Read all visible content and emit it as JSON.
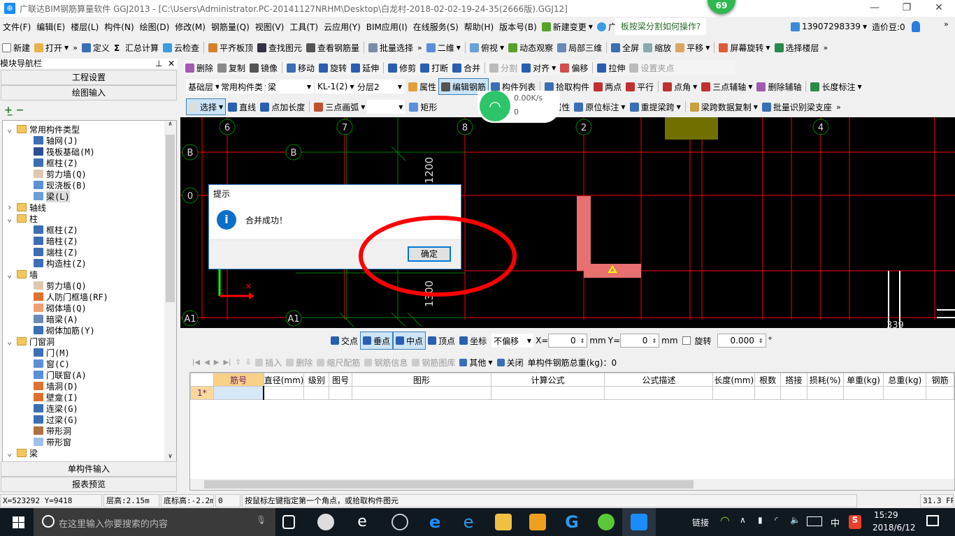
{
  "window": {
    "title": "广联达BIM钢筋算量软件 GGJ2013 - [C:\\Users\\Administrator.PC-20141127NRHM\\Desktop\\白龙村-2018-02-02-19-24-35(2666版).GGJ12]",
    "badge": "69"
  },
  "menu": {
    "items": [
      "文件(F)",
      "编辑(E)",
      "楼层(L)",
      "构件(N)",
      "绘图(D)",
      "修改(M)",
      "钢筋量(Q)",
      "视图(V)",
      "工具(T)",
      "云应用(Y)",
      "BIM应用(I)",
      "在线服务(S)",
      "帮助(H)",
      "版本号(B)"
    ],
    "new_change": "新建变更",
    "assistant": "广小二",
    "question": "板按梁分割如何操作?",
    "account": "13907298339",
    "beans": "造价豆:0"
  },
  "toolbar1": [
    {
      "label": "新建",
      "icon": "new-file-icon",
      "color": "#ffffff"
    },
    {
      "label": "打开",
      "icon": "open-folder-icon",
      "color": "#e8b44a",
      "dd": true
    },
    {
      "label": "»",
      "icon": ""
    },
    {
      "label": "定义",
      "icon": "define-icon",
      "color": "#3a6fb5"
    },
    {
      "label": "汇总计算",
      "icon": "sigma-icon",
      "color": ""
    },
    {
      "label": "云检查",
      "icon": "cloud-check-icon",
      "color": "#3b9be0"
    },
    {
      "label": "平齐板顶",
      "icon": "align-slab-icon",
      "color": "#d4822e"
    },
    {
      "label": "查找图元",
      "icon": "binoculars-icon",
      "color": "#334"
    },
    {
      "label": "查看钢筋量",
      "icon": "glasses-icon",
      "color": "#555"
    },
    {
      "label": "批量选择",
      "icon": "batch-select-icon",
      "color": "#7a8ca8"
    },
    {
      "label": "»",
      "icon": ""
    },
    {
      "label": "二维",
      "icon": "2d-icon",
      "color": "#5b8fd8",
      "dd": true
    },
    {
      "label": "俯视",
      "icon": "top-view-icon",
      "color": "#6aa0d8",
      "dd": true
    },
    {
      "label": "动态观察",
      "icon": "orbit-icon",
      "color": "#5aa02c"
    },
    {
      "label": "局部三维",
      "icon": "local-3d-icon",
      "color": "#6a8ab8"
    },
    {
      "label": "全屏",
      "icon": "fullscreen-icon",
      "color": "#3a6fb5"
    },
    {
      "label": "缩放",
      "icon": "zoom-icon",
      "color": "#8aa"
    },
    {
      "label": "平移",
      "icon": "pan-hand-icon",
      "color": "#d8a860",
      "dd": true
    },
    {
      "label": "屏幕旋转",
      "icon": "rotate-screen-icon",
      "color": "#e05a3a",
      "dd": true
    },
    {
      "label": "选择楼层",
      "icon": "select-floor-icon",
      "color": "#2a8a4a"
    },
    {
      "label": "»",
      "icon": ""
    }
  ],
  "toolbar2": [
    {
      "label": "删除",
      "icon": "delete-icon",
      "color": "#a05ab0"
    },
    {
      "label": "复制",
      "icon": "copy-icon",
      "color": "#8a8a8a"
    },
    {
      "label": "镜像",
      "icon": "mirror-icon",
      "color": "#555"
    },
    {
      "label": "移动",
      "icon": "move-icon",
      "color": "#3a6fb5"
    },
    {
      "label": "旋转",
      "icon": "rotate-icon",
      "color": "#2a5fb0"
    },
    {
      "label": "延伸",
      "icon": "extend-icon",
      "color": "#2a5fb0"
    },
    {
      "label": "修剪",
      "icon": "trim-icon",
      "color": "#2a5fb0"
    },
    {
      "label": "打断",
      "icon": "break-icon",
      "color": "#2a5fb0"
    },
    {
      "label": "合并",
      "icon": "merge-icon",
      "color": "#2a5fb0"
    },
    {
      "label": "分割",
      "icon": "split-icon",
      "color": "#bbb",
      "disabled": true
    },
    {
      "label": "对齐",
      "icon": "align-icon",
      "color": "#2a5fb0",
      "dd": true
    },
    {
      "label": "偏移",
      "icon": "offset-icon",
      "color": "#d05050"
    },
    {
      "label": "拉伸",
      "icon": "stretch-icon",
      "color": "#2a5fb0"
    },
    {
      "label": "设置夹点",
      "icon": "set-grip-icon",
      "color": "#bbb",
      "disabled": true
    }
  ],
  "toolbar3": {
    "selects": [
      "基础层",
      "常用构件类",
      "梁",
      "KL-1(2)",
      "分层2"
    ],
    "items": [
      {
        "label": "属性",
        "icon": "properties-icon",
        "color": "#e0a040"
      },
      {
        "label": "编辑钢筋",
        "icon": "edit-rebar-icon",
        "color": "#555",
        "active": true
      },
      {
        "label": "构件列表",
        "icon": "component-list-icon",
        "color": "#3a6fb5"
      },
      {
        "label": "拾取构件",
        "icon": "pick-component-icon",
        "color": "#3a6fb5"
      },
      {
        "label": "两点",
        "icon": "two-point-axis-icon",
        "color": "#c03030"
      },
      {
        "label": "平行",
        "icon": "parallel-axis-icon",
        "color": "#c03030"
      },
      {
        "label": "点角",
        "icon": "point-angle-icon",
        "color": "#c03030",
        "dd": true
      },
      {
        "label": "三点辅轴",
        "icon": "three-point-axis-icon",
        "color": "#c03030",
        "dd": true
      },
      {
        "label": "删除辅轴",
        "icon": "delete-axis-icon",
        "color": "#a05ab0"
      },
      {
        "label": "长度标注",
        "icon": "length-dimension-icon",
        "color": "#2a8a4a",
        "dd": true
      }
    ]
  },
  "toolbar4": {
    "left": [
      {
        "label": "选择",
        "icon": "cursor-icon",
        "color": "#ddd",
        "dd": true,
        "active": true
      },
      {
        "label": "直线",
        "icon": "line-icon",
        "color": "#2a5fb0"
      },
      {
        "label": "点加长度",
        "icon": "point-length-icon",
        "color": "#2a5fb0"
      },
      {
        "label": "三点画弧",
        "icon": "arc-icon",
        "color": "#c05030",
        "dd": true
      }
    ],
    "rect": {
      "label": "矩形",
      "icon": "rectangle-icon",
      "color": "#5b8fd8"
    },
    "right": [
      {
        "label": "梁段属性",
        "icon": "beam-segment-icon",
        "color": "#3a6fb5"
      },
      {
        "label": "原位标注",
        "icon": "in-place-mark-icon",
        "color": "#3a6fb5",
        "dd": true
      },
      {
        "label": "重提梁跨",
        "icon": "re-extract-span-icon",
        "color": "#3a6fb5",
        "dd": true
      },
      {
        "label": "梁跨数据复制",
        "icon": "brush-icon",
        "color": "#c8a040",
        "dd": true
      },
      {
        "label": "批量识别梁支座",
        "icon": "batch-support-icon",
        "color": "#3a6fb5"
      },
      {
        "label": "»",
        "icon": ""
      }
    ]
  },
  "network_widget": {
    "speed": "0.00K/s",
    "count": "0"
  },
  "nav": {
    "title": "模块导航栏",
    "project_settings": "工程设置",
    "drawing_input": "绘图输入",
    "single_input": "单构件输入",
    "report_preview": "报表预览",
    "tree": [
      {
        "label": "常用构件类型",
        "level": 0,
        "folder": true,
        "open": true
      },
      {
        "label": "轴网(J)",
        "level": 1,
        "color": "#3a6fb5"
      },
      {
        "label": "筏板基础(M)",
        "level": 1,
        "color": "#2a4f95"
      },
      {
        "label": "框柱(Z)",
        "level": 1,
        "color": "#3a6fb5"
      },
      {
        "label": "剪力墙(Q)",
        "level": 1,
        "color": "#e0c8b0"
      },
      {
        "label": "现浇板(B)",
        "level": 1,
        "color": "#5b8fd8"
      },
      {
        "label": "梁(L)",
        "level": 1,
        "color": "#6aa0d8",
        "selected": true
      },
      {
        "label": "轴线",
        "level": 0,
        "folder": true,
        "open": false
      },
      {
        "label": "柱",
        "level": 0,
        "folder": true,
        "open": true
      },
      {
        "label": "框柱(Z)",
        "level": 1,
        "color": "#3a6fb5"
      },
      {
        "label": "暗柱(Z)",
        "level": 1,
        "color": "#3a6fb5"
      },
      {
        "label": "端柱(Z)",
        "level": 1,
        "color": "#3a6fb5"
      },
      {
        "label": "构造柱(Z)",
        "level": 1,
        "color": "#3a6fb5"
      },
      {
        "label": "墙",
        "level": 0,
        "folder": true,
        "open": true
      },
      {
        "label": "剪力墙(Q)",
        "level": 1,
        "color": "#e0c8b0"
      },
      {
        "label": "人防门框墙(RF)",
        "level": 1,
        "color": "#e07030"
      },
      {
        "label": "砌体墙(Q)",
        "level": 1,
        "color": "#f0a070"
      },
      {
        "label": "暗梁(A)",
        "level": 1,
        "color": "#6a8ab8"
      },
      {
        "label": "砌体加筋(Y)",
        "level": 1,
        "color": "#3a6fb5"
      },
      {
        "label": "门窗洞",
        "level": 0,
        "folder": true,
        "open": true
      },
      {
        "label": "门(M)",
        "level": 1,
        "color": "#3a6fb5"
      },
      {
        "label": "窗(C)",
        "level": 1,
        "color": "#5b8fd8"
      },
      {
        "label": "门联窗(A)",
        "level": 1,
        "color": "#5b8fd8"
      },
      {
        "label": "墙洞(D)",
        "level": 1,
        "color": "#e07030"
      },
      {
        "label": "壁龛(I)",
        "level": 1,
        "color": "#e07030"
      },
      {
        "label": "连梁(G)",
        "level": 1,
        "color": "#3a6fb5"
      },
      {
        "label": "过梁(G)",
        "level": 1,
        "color": "#3a6fb5"
      },
      {
        "label": "带形洞",
        "level": 1,
        "color": "#b07040"
      },
      {
        "label": "带形窗",
        "level": 1,
        "color": "#a0c0e8"
      },
      {
        "label": "梁",
        "level": 0,
        "folder": true,
        "open": true
      }
    ]
  },
  "canvas": {
    "axis_labels": {
      "top": [
        "6",
        "7",
        "8",
        "2",
        "4"
      ],
      "left": [
        "B",
        "B",
        "0",
        "A1",
        "A1"
      ]
    },
    "dimensions": [
      "1200",
      "1300",
      "339"
    ]
  },
  "dialog": {
    "title": "提示",
    "message": "合并成功！",
    "ok": "确定"
  },
  "snapbar": {
    "items": [
      {
        "label": "交点",
        "icon": "intersection-icon"
      },
      {
        "label": "垂点",
        "icon": "perpendicular-icon",
        "active": true
      },
      {
        "label": "中点",
        "icon": "midpoint-icon",
        "active": true
      },
      {
        "label": "顶点",
        "icon": "vertex-icon"
      },
      {
        "label": "坐标",
        "icon": "coordinate-icon"
      }
    ],
    "offset_mode": "不偏移",
    "x_label": "X=",
    "x_value": "0",
    "y_label": "Y=",
    "y_value": "0",
    "unit": "mm",
    "rotate_label": "旋转",
    "rotate_value": "0.000",
    "degree": "°",
    "rotate_checked": false
  },
  "rebar_panel": {
    "toolbar": [
      {
        "label": "插入",
        "disabled": true
      },
      {
        "label": "删除",
        "disabled": true
      },
      {
        "label": "缩尺配筋",
        "disabled": true
      },
      {
        "label": "钢筋信息",
        "disabled": true
      },
      {
        "label": "钢筋图库",
        "disabled": true
      },
      {
        "label": "其他",
        "dd": true
      },
      {
        "label": "关闭"
      }
    ],
    "total_weight": "单构件钢筋总重(kg)：0",
    "columns": [
      "筋号",
      "直径(mm)",
      "级别",
      "图号",
      "图形",
      "计算公式",
      "公式描述",
      "长度(mm)",
      "根数",
      "搭接",
      "损耗(%)",
      "单重(kg)",
      "总重(kg)",
      "钢筋"
    ],
    "rows": [
      {
        "index": "1*"
      }
    ]
  },
  "statusbar": [
    "X=523292 Y=9418",
    "层高:2.15m",
    "底标高:-2.2m",
    "0",
    "按鼠标左键指定第一个角点，或拾取构件图元",
    "31.3 FPS"
  ],
  "taskbar": {
    "search_placeholder": "在这里输入你要搜索的内容",
    "tray_link": "链接",
    "ime": "中",
    "time": "15:29",
    "date": "2018/6/12"
  },
  "colors": {
    "canvas_bg": "#000000",
    "grid_red": "#ff0000",
    "grid_green": "#008000",
    "beam_pink": "#e87070",
    "annotation_red": "#ff0000",
    "accent_blue": "#0078d7"
  }
}
